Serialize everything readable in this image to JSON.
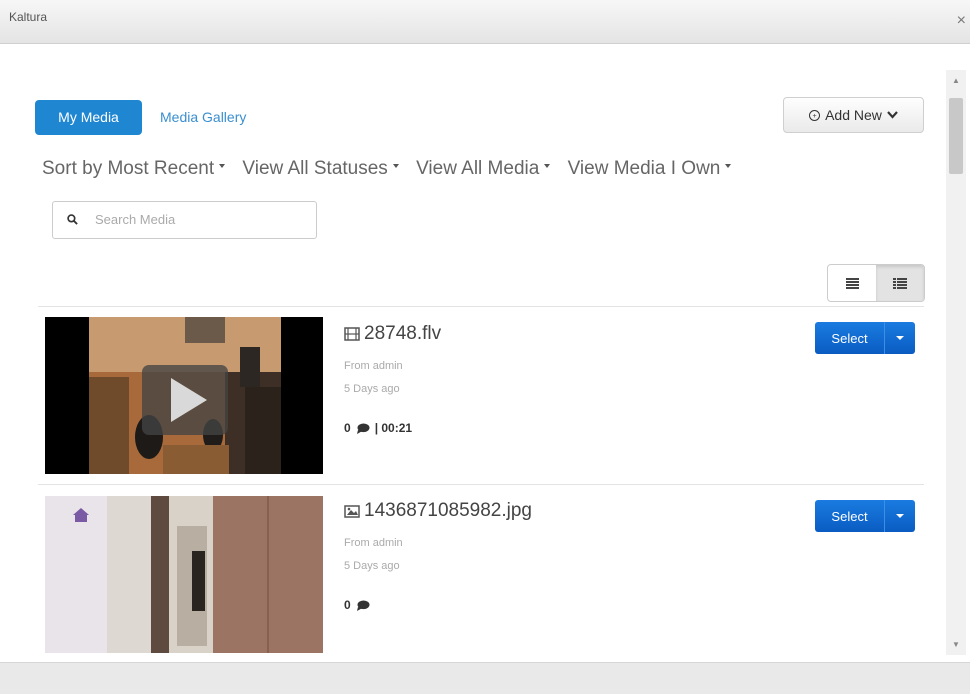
{
  "window": {
    "title": "Kaltura",
    "close_glyph": "×"
  },
  "tabs": [
    {
      "label": "My Media",
      "active": true
    },
    {
      "label": "Media Gallery",
      "active": false
    }
  ],
  "add_new": {
    "label": "Add New",
    "icon": "plus-circle-icon"
  },
  "filters": [
    {
      "label": "Sort by Most Recent"
    },
    {
      "label": "View All Statuses"
    },
    {
      "label": "View All Media"
    },
    {
      "label": "View Media I Own"
    }
  ],
  "search": {
    "placeholder": "Search Media",
    "value": ""
  },
  "colors": {
    "accent": "#1f86d1",
    "select_button": "#0a5cc2",
    "link": "#3a8fd0"
  },
  "media": [
    {
      "title": "28748.flv",
      "type_icon": "film-icon",
      "from": "From admin",
      "age": "5 Days ago",
      "comments": "0",
      "duration": "| 00:21",
      "select_label": "Select"
    },
    {
      "title": "1436871085982.jpg",
      "type_icon": "image-icon",
      "from": "From admin",
      "age": "5 Days ago",
      "comments": "0",
      "duration": "",
      "select_label": "Select"
    }
  ]
}
